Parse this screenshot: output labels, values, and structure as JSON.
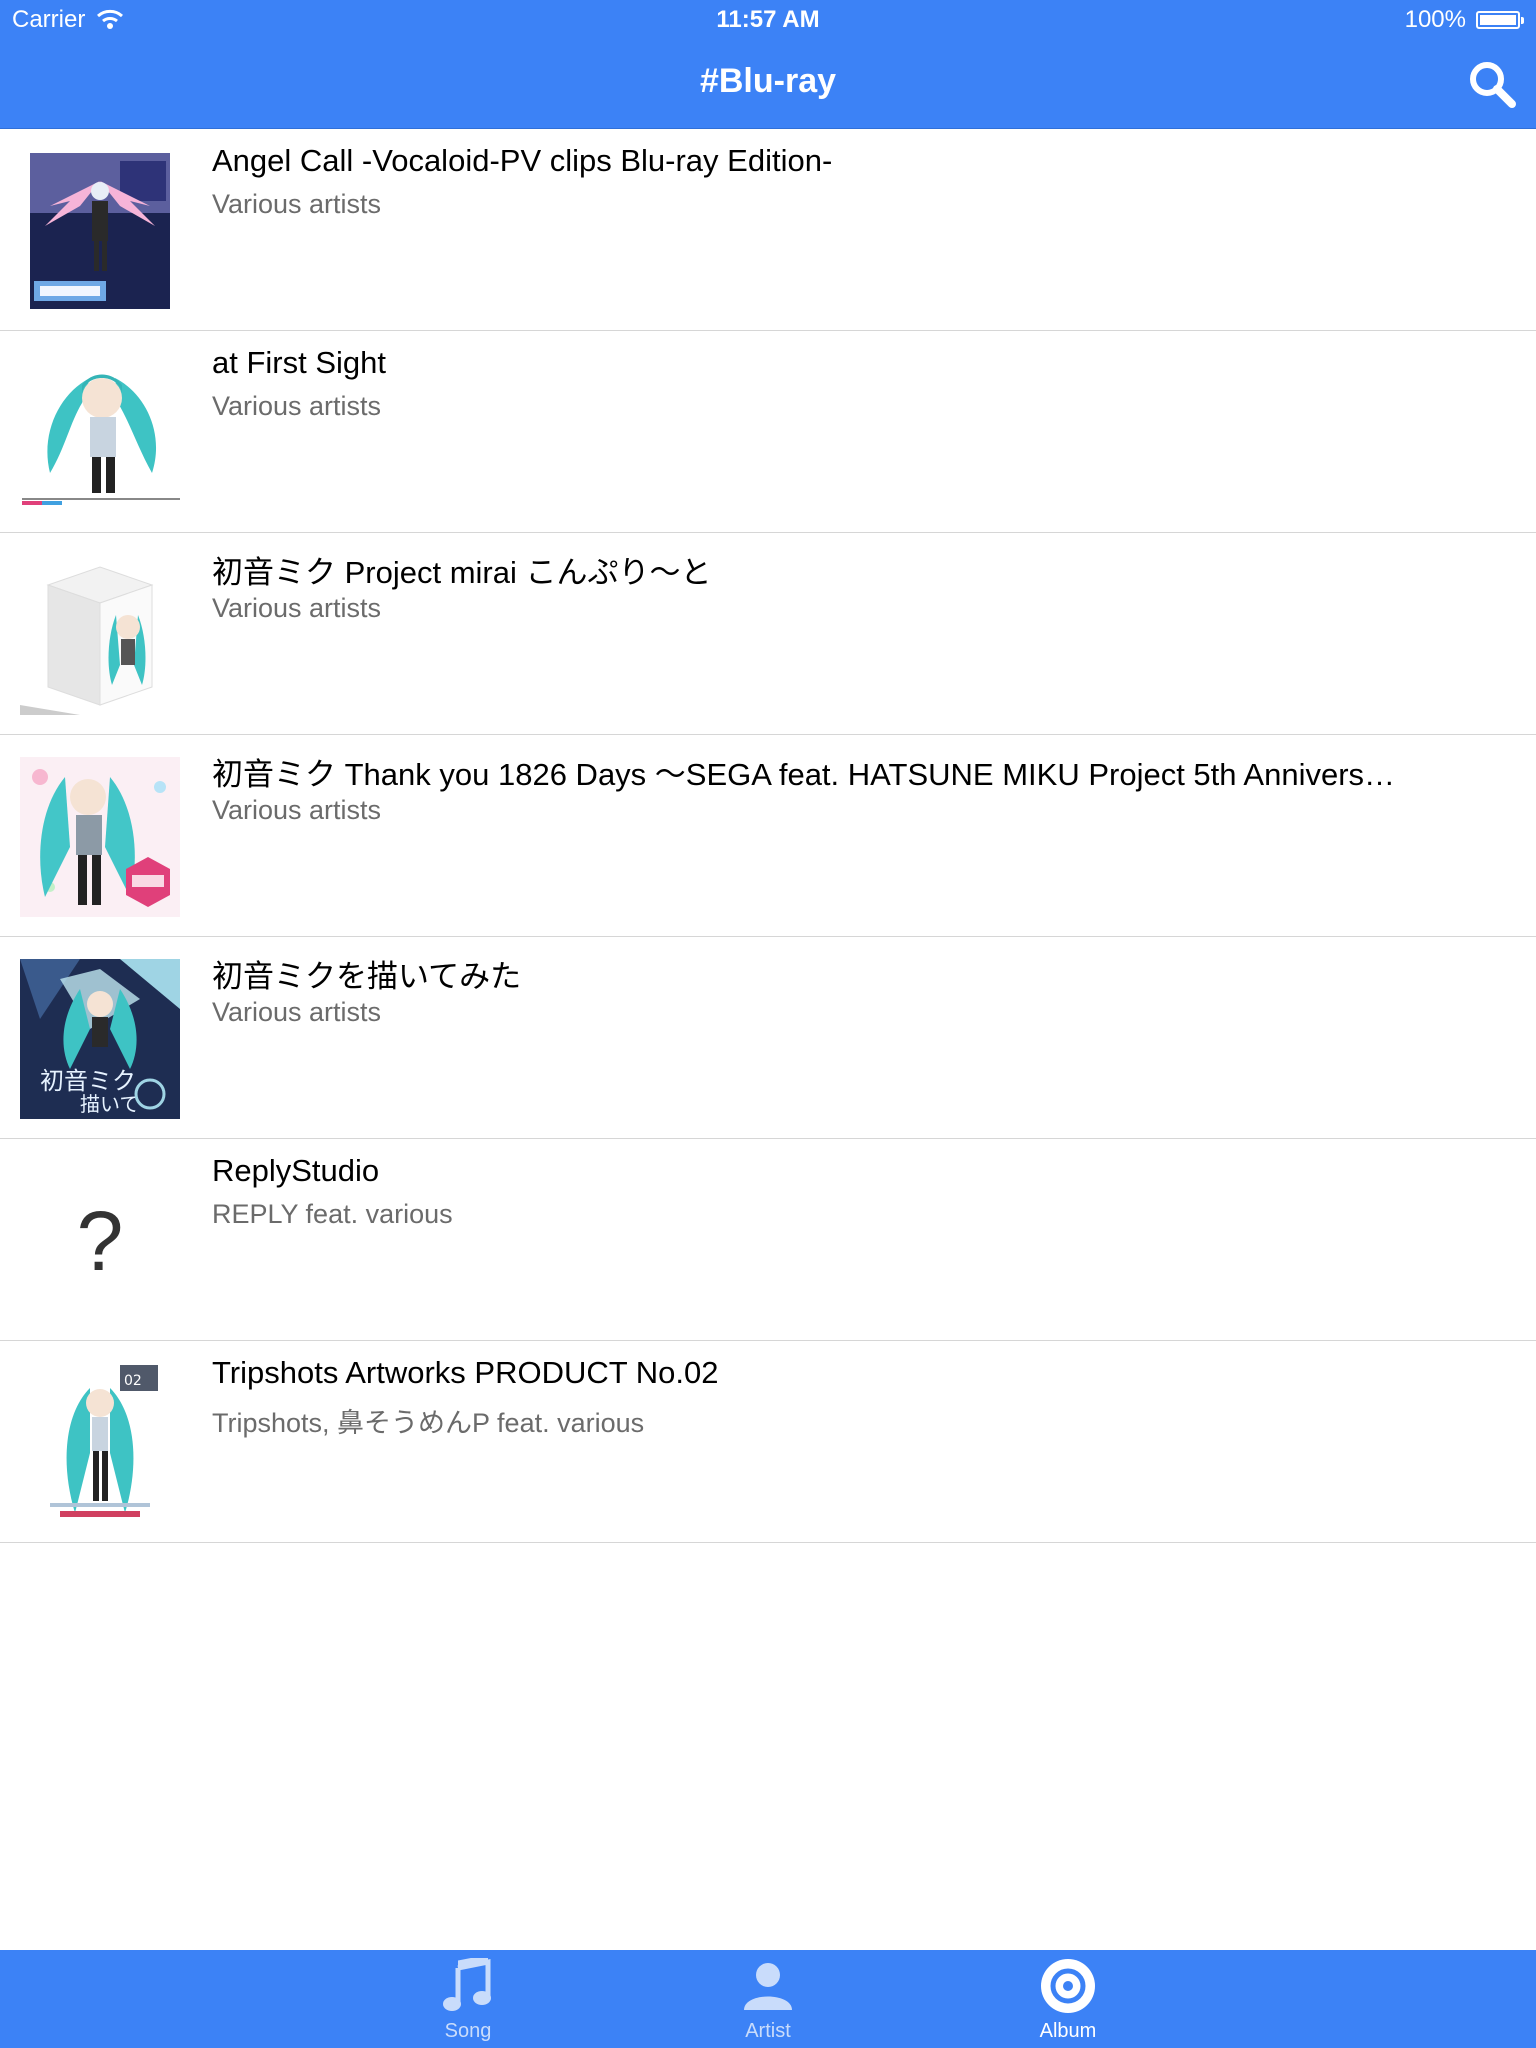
{
  "status_bar": {
    "carrier": "Carrier",
    "time": "11:57 AM",
    "battery": "100%"
  },
  "nav": {
    "title": "#Blu-ray",
    "search_icon": "search-icon"
  },
  "albums": [
    {
      "title": "Angel Call -Vocaloid-PV clips Blu-ray Edition-",
      "artist": "Various artists",
      "art": "art-angel-call"
    },
    {
      "title": "at First Sight",
      "artist": "Various artists",
      "art": "art-at-first-sight"
    },
    {
      "title": "初音ミク Project mirai こんぷり〜と",
      "artist": "Various artists",
      "art": "art-mirai-box"
    },
    {
      "title": "初音ミク Thank you 1826 Days 〜SEGA feat. HATSUNE MIKU Project 5th Annivers…",
      "artist": "Various artists",
      "art": "art-thank-you-1826"
    },
    {
      "title": "初音ミクを描いてみた",
      "artist": "Various artists",
      "art": "art-kaitemita"
    },
    {
      "title": "ReplyStudio",
      "artist": "REPLY feat. various",
      "art": "?"
    },
    {
      "title": "Tripshots Artworks PRODUCT No.02",
      "artist": "Tripshots, 鼻そうめんP feat. various",
      "art": "art-tripshots"
    }
  ],
  "tabs": [
    {
      "label": "Song",
      "icon": "music-note-icon",
      "active": false
    },
    {
      "label": "Artist",
      "icon": "person-icon",
      "active": false
    },
    {
      "label": "Album",
      "icon": "disc-icon",
      "active": true
    }
  ],
  "colors": {
    "bar": "#3c82f6",
    "separator": "#d6d6d6",
    "subtitle": "#6b6b6b",
    "tab_inactive": "#c9dcfb"
  }
}
